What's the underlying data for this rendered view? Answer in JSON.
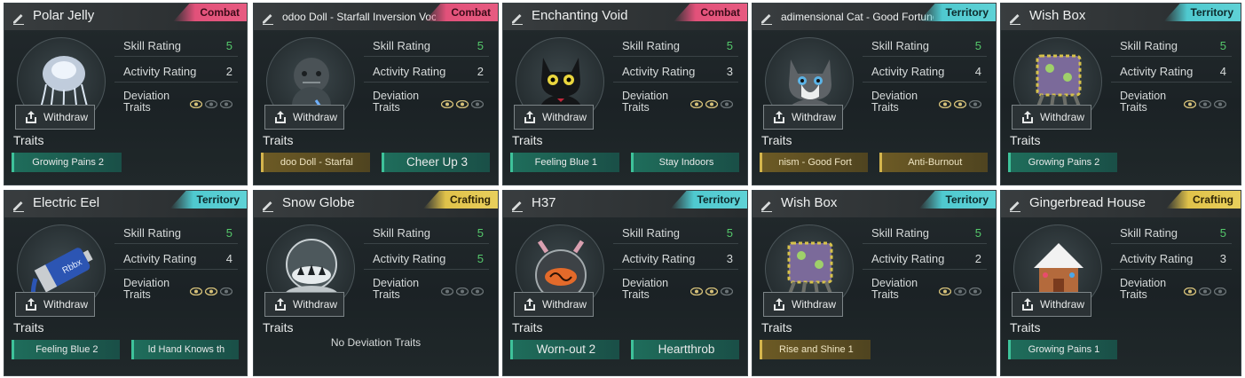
{
  "colors": {
    "combat": "#e75b81",
    "territory": "#5fd2d6",
    "crafting": "#e8cf5c",
    "rating_high": "#55c86b",
    "trait_green": "#1f6d5b",
    "trait_gold": "#6c5a25"
  },
  "labels": {
    "skill": "Skill Rating",
    "activity": "Activity Rating",
    "deviation_line1": "Deviation",
    "deviation_line2": "Traits",
    "withdraw": "Withdraw",
    "traits": "Traits"
  },
  "cards": [
    {
      "name": "Polar Jelly",
      "small": false,
      "category": "Combat",
      "cat_class": "combat",
      "skill": "5",
      "activity": "2",
      "eyes": [
        true,
        false,
        false
      ],
      "icon": "jellyfish-icon",
      "traits": [
        {
          "label": "Growing Pains 2",
          "color": "green",
          "big": false
        }
      ]
    },
    {
      "name": "odoo Doll - Starfall Inversion   Voc",
      "small": true,
      "category": "Combat",
      "cat_class": "combat",
      "skill": "5",
      "activity": "2",
      "eyes": [
        true,
        true,
        false
      ],
      "icon": "voodoo-doll-icon",
      "traits": [
        {
          "label": "doo Doll - Starfal",
          "color": "gold",
          "big": false
        },
        {
          "label": "Cheer Up 3",
          "color": "green",
          "big": true
        }
      ]
    },
    {
      "name": "Enchanting Void",
      "small": false,
      "category": "Combat",
      "cat_class": "combat",
      "skill": "5",
      "activity": "3",
      "eyes": [
        true,
        true,
        false
      ],
      "icon": "black-cat-icon",
      "traits": [
        {
          "label": "Feeling Blue 1",
          "color": "green",
          "big": false
        },
        {
          "label": "Stay Indoors",
          "color": "green",
          "big": false
        }
      ]
    },
    {
      "name": "adimensional Cat - Good Fortune",
      "small": true,
      "category": "Territory",
      "cat_class": "territory",
      "skill": "5",
      "activity": "4",
      "eyes": [
        true,
        true,
        false
      ],
      "icon": "cat-icon",
      "traits": [
        {
          "label": "nism - Good Fort",
          "color": "gold",
          "big": false
        },
        {
          "label": "Anti-Burnout",
          "color": "gold",
          "big": false
        }
      ]
    },
    {
      "name": "Wish Box",
      "small": false,
      "category": "Territory",
      "cat_class": "territory",
      "skill": "5",
      "activity": "4",
      "eyes": [
        true,
        false,
        false
      ],
      "icon": "wish-box-icon",
      "traits": [
        {
          "label": "Growing Pains 2",
          "color": "green",
          "big": false
        }
      ]
    },
    {
      "name": "Electric Eel",
      "small": false,
      "category": "Territory",
      "cat_class": "territory",
      "skill": "5",
      "activity": "4",
      "eyes": [
        true,
        true,
        false
      ],
      "icon": "battery-eel-icon",
      "traits": [
        {
          "label": "Feeling Blue 2",
          "color": "green",
          "big": false
        },
        {
          "label": "ld Hand Knows th",
          "color": "green",
          "big": false
        }
      ]
    },
    {
      "name": "Snow Globe",
      "small": false,
      "category": "Crafting",
      "cat_class": "crafting",
      "skill": "5",
      "activity": "5",
      "eyes": [
        false,
        false,
        false
      ],
      "icon": "snow-globe-icon",
      "traits": [],
      "no_traits": "No Deviation Traits"
    },
    {
      "name": "H37",
      "small": false,
      "category": "Territory",
      "cat_class": "territory",
      "skill": "5",
      "activity": "3",
      "eyes": [
        true,
        true,
        false
      ],
      "icon": "robot-orb-icon",
      "traits": [
        {
          "label": "Worn-out 2",
          "color": "green",
          "big": true
        },
        {
          "label": "Heartthrob",
          "color": "green",
          "big": true
        }
      ]
    },
    {
      "name": "Wish Box",
      "small": false,
      "category": "Territory",
      "cat_class": "territory",
      "skill": "5",
      "activity": "2",
      "eyes": [
        true,
        false,
        false
      ],
      "icon": "wish-box-icon",
      "traits": [
        {
          "label": "Rise and Shine 1",
          "color": "gold",
          "big": false
        }
      ]
    },
    {
      "name": "Gingerbread House",
      "small": false,
      "category": "Crafting",
      "cat_class": "crafting",
      "skill": "5",
      "activity": "3",
      "eyes": [
        true,
        false,
        false
      ],
      "icon": "gingerbread-house-icon",
      "traits": [
        {
          "label": "Growing Pains 1",
          "color": "green",
          "big": false
        }
      ]
    }
  ]
}
